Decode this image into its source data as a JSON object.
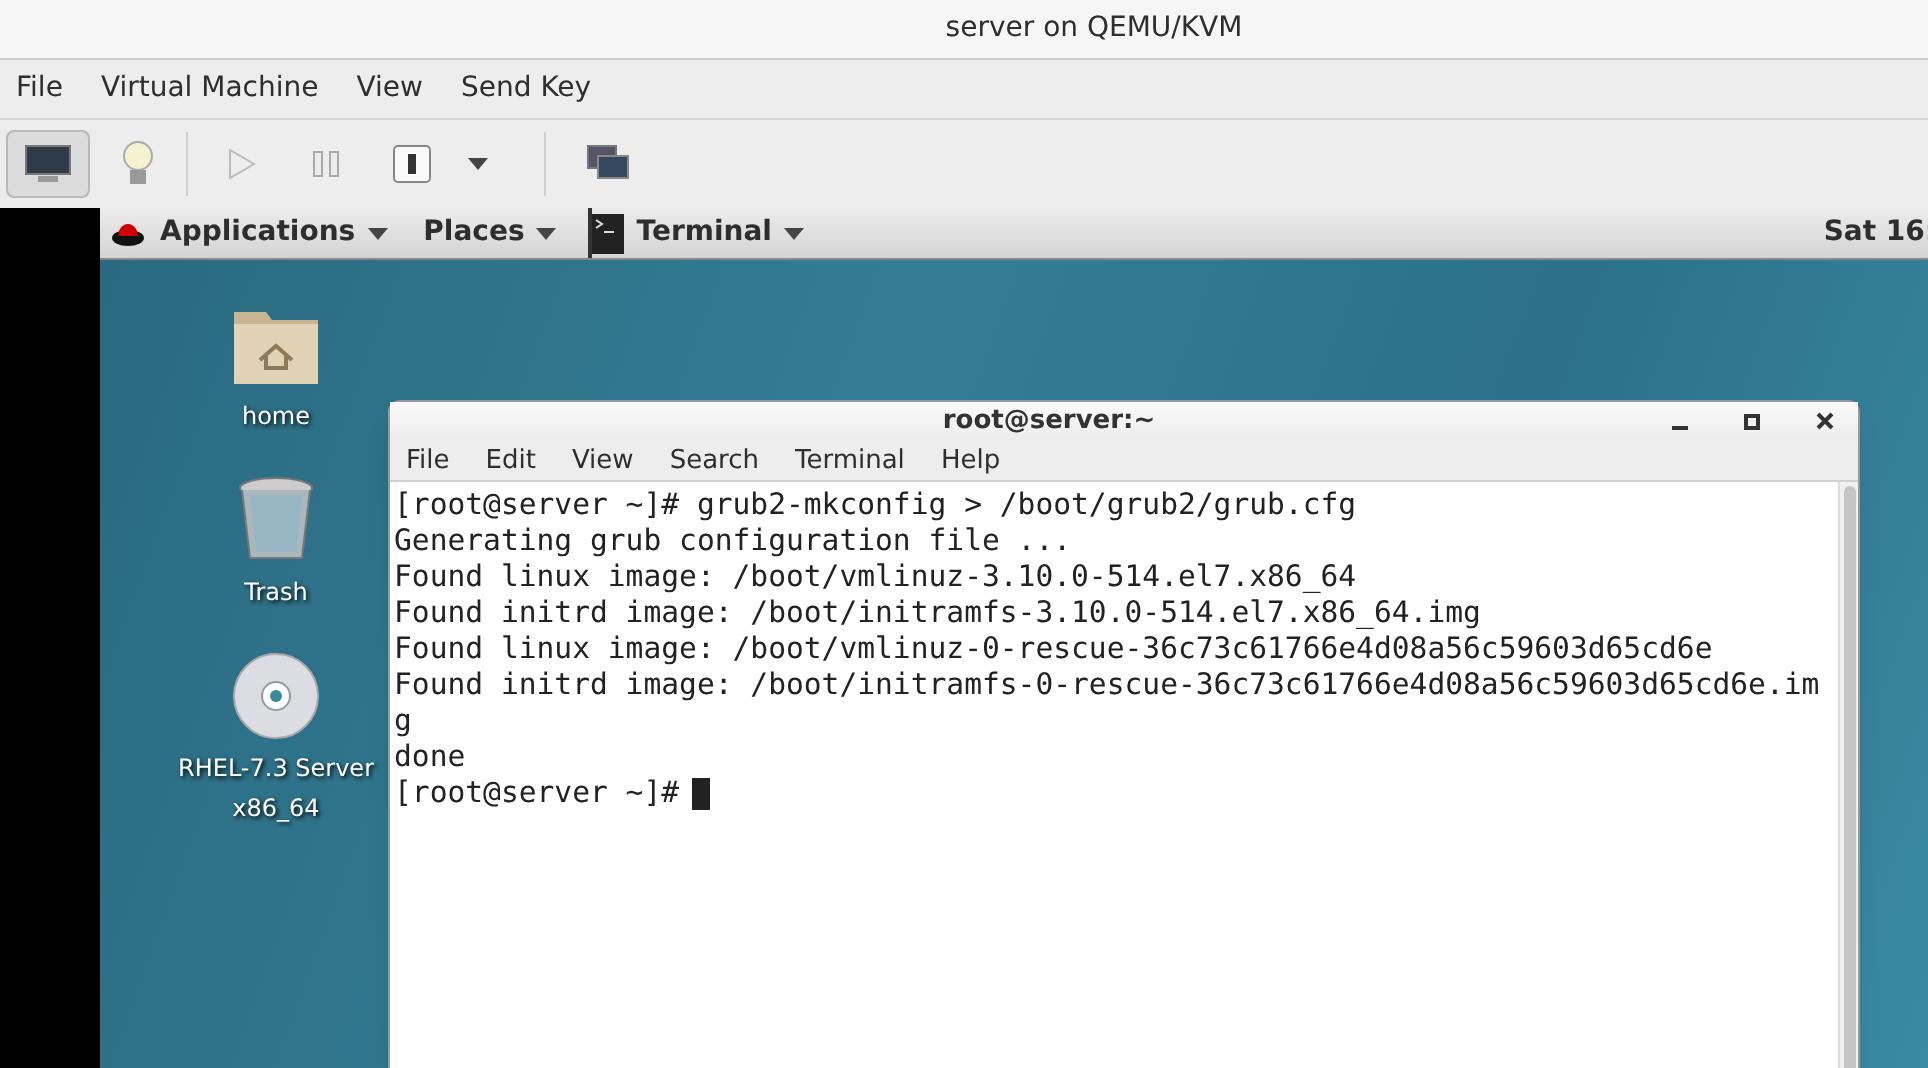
{
  "window": {
    "title": "server on QEMU/KVM"
  },
  "menu": [
    "File",
    "Virtual Machine",
    "View",
    "Send Key"
  ],
  "toolbar": {
    "console_selected": true
  },
  "gnome_bar": {
    "applications": "Applications",
    "places": "Places",
    "terminal": "Terminal",
    "clock": "Sat 16:"
  },
  "desktop_icons": [
    {
      "kind": "home",
      "label": "home"
    },
    {
      "kind": "trash",
      "label": "Trash"
    },
    {
      "kind": "disc",
      "label": "RHEL-7.3 Server",
      "label_2": "x86_64"
    }
  ],
  "terminal": {
    "title": "root@server:~",
    "menu": [
      "File",
      "Edit",
      "View",
      "Search",
      "Terminal",
      "Help"
    ],
    "lines": [
      "[root@server ~]# grub2-mkconfig > /boot/grub2/grub.cfg",
      "Generating grub configuration file ...",
      "Found linux image: /boot/vmlinuz-3.10.0-514.el7.x86_64",
      "Found initrd image: /boot/initramfs-3.10.0-514.el7.x86_64.img",
      "Found linux image: /boot/vmlinuz-0-rescue-36c73c61766e4d08a56c59603d65cd6e",
      "Found initrd image: /boot/initramfs-0-rescue-36c73c61766e4d08a56c59603d65cd6e.im",
      "g",
      "done"
    ],
    "prompt": "[root@server ~]#"
  }
}
